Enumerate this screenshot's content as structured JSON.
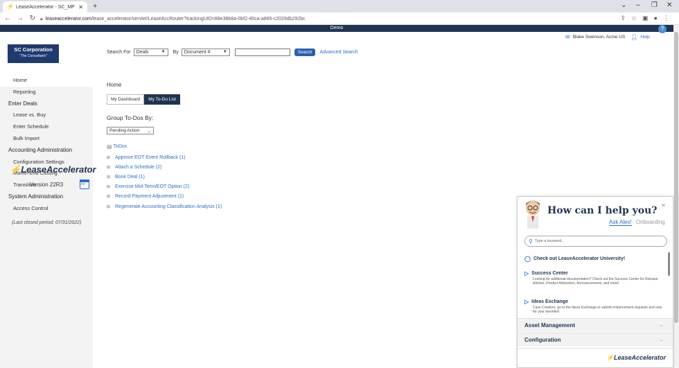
{
  "browser": {
    "tab_title": "LeaseAccelerator - SC_MP - lsswi",
    "url_host": "leaseaccelerator.com",
    "url_path": "/lease_accelerator/servlet/LeaseAccRouter?trackingUID=88e38b8a-0bf2-40ca-a865-c2029db292bc"
  },
  "header": {
    "env_label": "Demo",
    "user": "Blake Swenson, Acme US",
    "help": "Help",
    "company": "SC Corporation",
    "tagline": "\"The Consultants\""
  },
  "search": {
    "search_for_label": "Search For",
    "search_for_value": "Deals",
    "by_label": "By",
    "by_value": "Document #",
    "input_value": "",
    "search_button": "Search",
    "advanced_link": "Advanced Search"
  },
  "sidebar": {
    "items": [
      {
        "label": "Home",
        "type": "item"
      },
      {
        "label": "Reporting",
        "type": "item"
      },
      {
        "label": "Enter Deals",
        "type": "section"
      },
      {
        "label": "Lease vs. Buy",
        "type": "item"
      },
      {
        "label": "Enter Schedule",
        "type": "item"
      },
      {
        "label": "Bulk Import",
        "type": "item"
      },
      {
        "label": "Accounting Administration",
        "type": "section"
      },
      {
        "label": "Configuration Settings",
        "type": "item"
      },
      {
        "label": "Month-End Closing",
        "type": "item"
      },
      {
        "label": "Transition",
        "type": "item"
      },
      {
        "label": "System Administration",
        "type": "section"
      },
      {
        "label": "Access Control",
        "type": "item"
      }
    ],
    "closed_period": "(Last closed period: 07/31/2022)",
    "brand": "LeaseAccelerator",
    "version": "Version 22R3"
  },
  "main": {
    "title": "Home",
    "tabs": [
      "My Dashboard",
      "My To-Do List"
    ],
    "active_tab": "My To-Do List",
    "group_label": "Group To-Dos By:",
    "group_value": "Pending Action",
    "todos_root": "ToDos",
    "todos": [
      "Approve EOT Event Rollback (1)",
      "Attach a Schedule (2)",
      "Book Deal (1)",
      "Exercise Mid-Term/EOT Option (2)",
      "Record Payment Adjustment (1)",
      "Regenerate Accounting Classification Analysis (1)"
    ]
  },
  "chat": {
    "headline": "How can I help you?",
    "tab_active": "Ask Alex!",
    "tab_other": "Onboarding",
    "search_placeholder": "Type a keyword...",
    "university_link": "Check out LeaseAccelerator University!",
    "entries": [
      {
        "title": "Success Center",
        "desc": "Looking for additional documentation? Check out the Success Center for Release Articles, Product Advisories, Announcements, and more!"
      },
      {
        "title": "Ideas Exchange",
        "desc": "Case Creators- go to the Ideas Exchange to submit enhancement requests and vote for your favorites!"
      }
    ],
    "accordions": [
      "Asset Management",
      "Configuration"
    ],
    "brand": "LeaseAccelerator"
  },
  "colors": {
    "navy": "#1f3450",
    "link": "#2a6dc9",
    "brand_green": "#5aa832"
  }
}
